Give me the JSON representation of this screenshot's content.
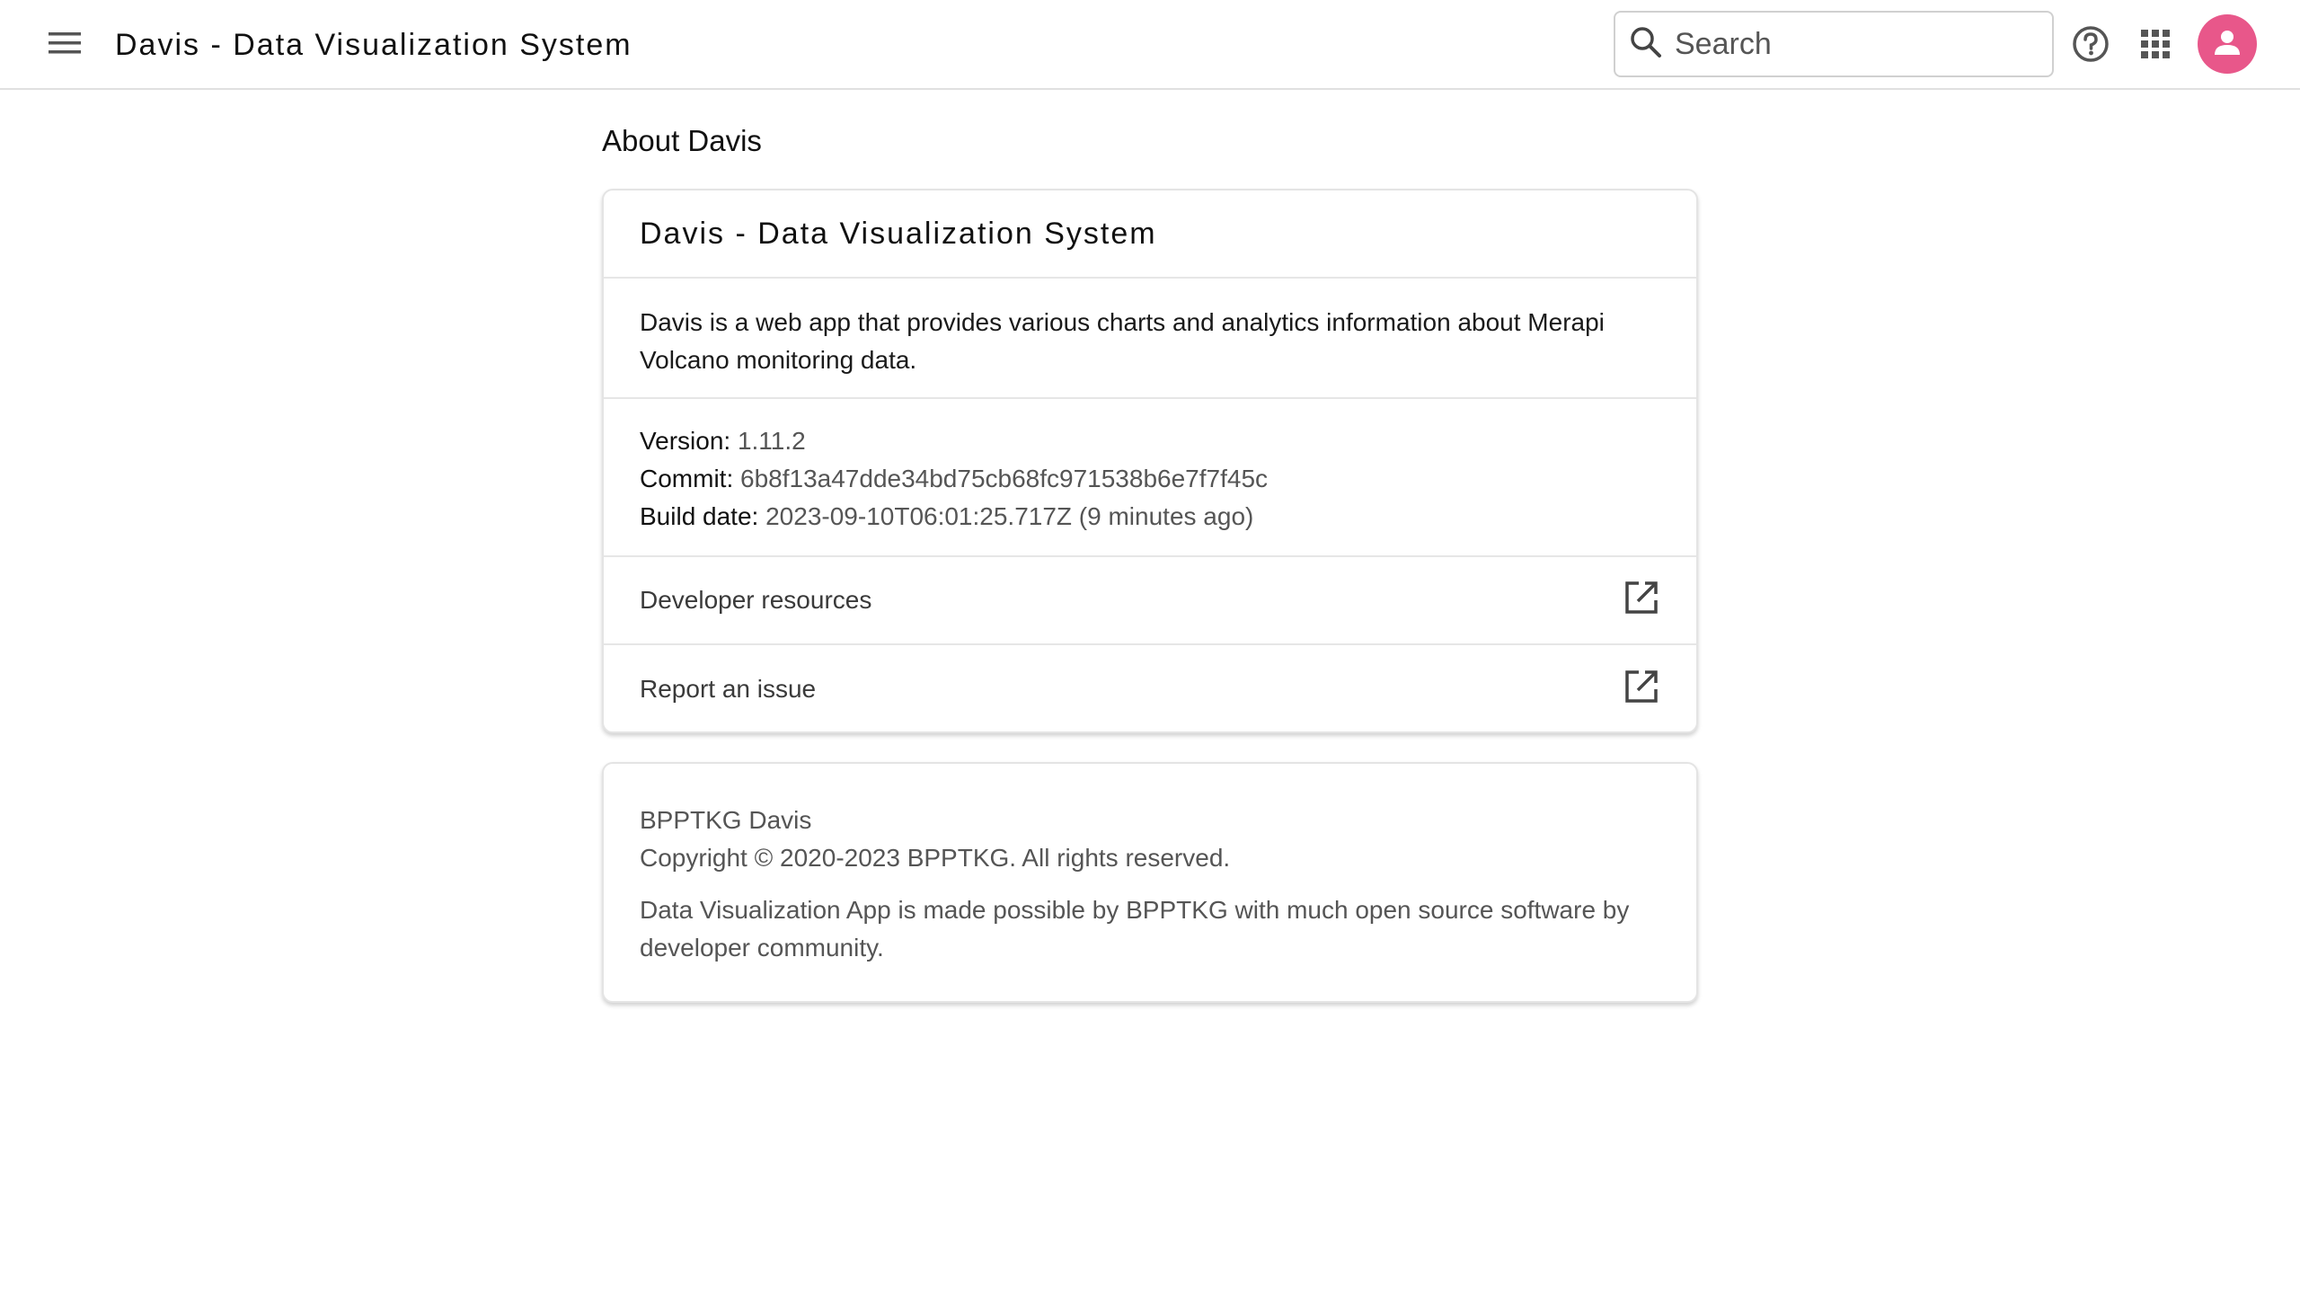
{
  "app": {
    "title": "Davis - Data Visualization System"
  },
  "header": {
    "search": {
      "placeholder": "Search",
      "value": ""
    },
    "icons": {
      "menu": "menu-icon",
      "search": "search-icon",
      "help": "help-circle-icon",
      "apps": "apps-grid-icon",
      "avatar": "user-avatar-icon"
    },
    "avatar_color": "#e8578a"
  },
  "page": {
    "heading": "About Davis"
  },
  "about_card": {
    "title": "Davis - Data Visualization System",
    "description": "Davis is a web app that provides various charts and analytics information about Merapi Volcano monitoring data.",
    "version_label": "Version:",
    "version_value": "1.11.2",
    "commit_label": "Commit:",
    "commit_value": "6b8f13a47dde34bd75cb68fc971538b6e7f7f45c",
    "build_label": "Build date:",
    "build_value": "2023-09-10T06:01:25.717Z (9 minutes ago)",
    "links": [
      {
        "label": "Developer resources",
        "icon": "open-in-new-icon"
      },
      {
        "label": "Report an issue",
        "icon": "open-in-new-icon"
      }
    ]
  },
  "footer_card": {
    "name": "BPPTKG Davis",
    "copyright": "Copyright © 2020-2023 BPPTKG. All rights reserved.",
    "credits": "Data Visualization App is made possible by BPPTKG with much open source software by developer community."
  }
}
